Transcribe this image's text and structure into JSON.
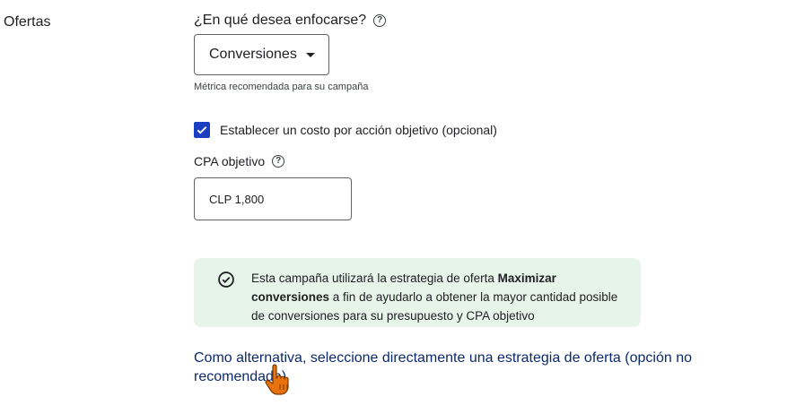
{
  "section": {
    "label": "Ofertas"
  },
  "focus": {
    "question": "¿En qué desea enfocarse?",
    "selected": "Conversiones",
    "helper": "Métrica recomendada para su campaña"
  },
  "cpa": {
    "checkbox_label": "Establecer un costo por acción objetivo (opcional)",
    "checked": true,
    "label": "CPA objetivo",
    "value": "CLP 1,800"
  },
  "notice": {
    "text_before": "Esta campaña utilizará la estrategia de oferta ",
    "bold": "Maximizar conversiones",
    "text_after": " a fin de ayudarlo a obtener la mayor cantidad posible de conversiones para su presupuesto y CPA objetivo"
  },
  "alternative_link": "Como alternativa, seleccione directamente una estrategia de oferta (opción no recomendada)",
  "colors": {
    "checkbox": "#1a3fc0",
    "notice_bg": "#e6f4ea",
    "link": "#0b2a6b",
    "cursor": "#e8720c"
  },
  "icons": [
    "help-icon",
    "chevron-down-icon",
    "check-icon",
    "check-circle-icon",
    "hand-pointer-icon"
  ]
}
